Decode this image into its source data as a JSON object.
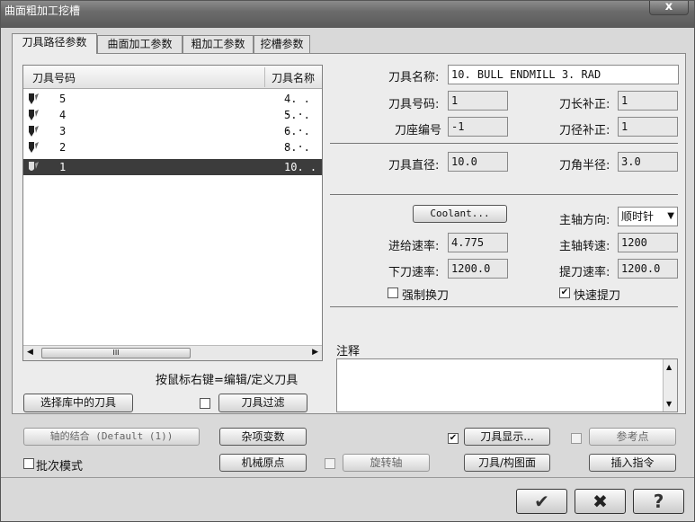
{
  "window": {
    "title": "曲面粗加工挖槽",
    "close_glyph": "x"
  },
  "tabs": [
    {
      "label": "刀具路径参数",
      "active": true
    },
    {
      "label": "曲面加工参数",
      "active": false
    },
    {
      "label": "粗加工参数",
      "active": false
    },
    {
      "label": "挖槽参数",
      "active": false
    }
  ],
  "tool_list": {
    "columns": [
      "刀具号码",
      "刀具名称"
    ],
    "rows": [
      {
        "num": "5",
        "name": "4. . . .",
        "selected": false
      },
      {
        "num": "4",
        "name": "5. . . .",
        "selected": false
      },
      {
        "num": "3",
        "name": "6. . . .",
        "selected": false
      },
      {
        "num": "2",
        "name": "8. . . .",
        "selected": false
      },
      {
        "num": "1",
        "name": "10. . . .",
        "selected": true
      }
    ],
    "scroll_thumb": "III"
  },
  "hint": "按鼠标右键=编辑/定义刀具",
  "buttons": {
    "select_lib": "选择库中的刀具",
    "tool_filter": "刀具过滤",
    "coolant": "Coolant...",
    "axis_combo": "轴的结合 (Default (1))",
    "misc_vars": "杂项变数",
    "tool_display": "刀具显示...",
    "ref_point": "参考点",
    "machine_origin": "机械原点",
    "rotary_axis": "旋转轴",
    "tool_plane": "刀具/构图面",
    "insert_cmd": "插入指令",
    "ok_glyph": "✔",
    "cancel_glyph": "✖",
    "help_glyph": "?"
  },
  "fields": {
    "tool_name_label": "刀具名称:",
    "tool_name": "10. BULL ENDMILL 3. RAD",
    "tool_num_label": "刀具号码:",
    "tool_num": "1",
    "len_comp_label": "刀长补正:",
    "len_comp": "1",
    "holder_label": "刀座编号",
    "holder": "-1",
    "dia_comp_label": "刀径补正:",
    "dia_comp": "1",
    "diameter_label": "刀具直径:",
    "diameter": "10.0",
    "corner_label": "刀角半径:",
    "corner": "3.0",
    "spindle_dir_label": "主轴方向:",
    "spindle_dir": "顺时针",
    "feed_label": "进给速率:",
    "feed": "4.775",
    "spindle_speed_label": "主轴转速:",
    "spindle_speed": "1200",
    "plunge_label": "下刀速率:",
    "plunge": "1200.0",
    "retract_label": "提刀速率:",
    "retract": "1200.0",
    "force_change_label": "强制换刀",
    "force_change": false,
    "rapid_retract_label": "快速提刀",
    "rapid_retract": true,
    "notes_label": "注释",
    "batch_label": "批次模式",
    "batch": false,
    "tool_filter_checked": false,
    "tool_display_checked": true,
    "ref_point_checked": false,
    "rotary_checked": false
  }
}
